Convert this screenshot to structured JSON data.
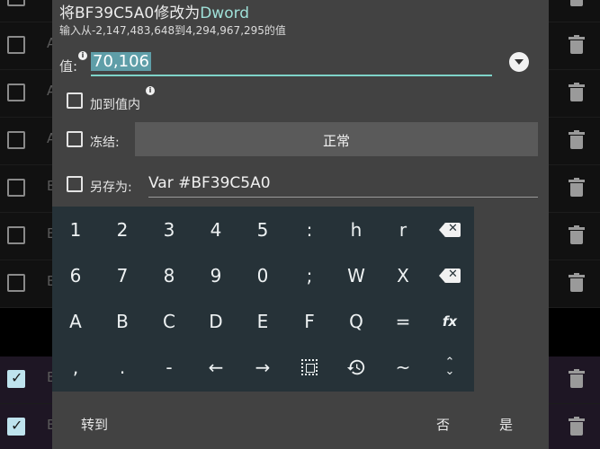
{
  "background": {
    "rows": [
      {
        "letter": "A",
        "checked": false,
        "selected": false
      },
      {
        "letter": "A",
        "checked": false,
        "selected": false
      },
      {
        "letter": "A",
        "checked": false,
        "selected": false
      },
      {
        "letter": "A",
        "checked": false,
        "selected": false
      },
      {
        "letter": "B",
        "checked": false,
        "selected": false
      },
      {
        "letter": "B",
        "checked": false,
        "selected": false
      },
      {
        "letter": "B",
        "checked": false,
        "selected": false
      },
      {
        "letter": "B",
        "checked": true,
        "selected": true
      },
      {
        "letter": "B",
        "checked": true,
        "selected": true
      }
    ]
  },
  "dialog": {
    "title_prefix": "将BF39C5A0修改为",
    "title_type": "Dword",
    "subtitle": "输入从-2,147,483,648到4,294,967,295的值",
    "value_label": "值:",
    "value": "70,106",
    "add_to_value_label": "加到值内",
    "freeze_label": "冻结:",
    "freeze_mode": "正常",
    "save_as_label": "另存为:",
    "save_as_value": "Var #BF39C5A0",
    "goto_button": "转到",
    "no_button": "否",
    "yes_button": "是",
    "info_glyph": "i"
  },
  "keyboard": {
    "rows": [
      [
        "1",
        "2",
        "3",
        "4",
        "5",
        ":",
        "h",
        "r",
        "backspace"
      ],
      [
        "6",
        "7",
        "8",
        "9",
        "0",
        ";",
        "W",
        "X",
        "delete"
      ],
      [
        "A",
        "B",
        "C",
        "D",
        "E",
        "F",
        "Q",
        "=",
        "fx"
      ],
      [
        ",",
        ".",
        "-",
        "←",
        "→",
        "select",
        "history",
        "~",
        "collapse"
      ]
    ],
    "collapse_glyph": "⌃⌄"
  },
  "colors": {
    "dialog_bg": "#424242",
    "keyboard_bg": "#263238",
    "accent": "#7ed3c9",
    "type_text": "#9fe0d8"
  }
}
